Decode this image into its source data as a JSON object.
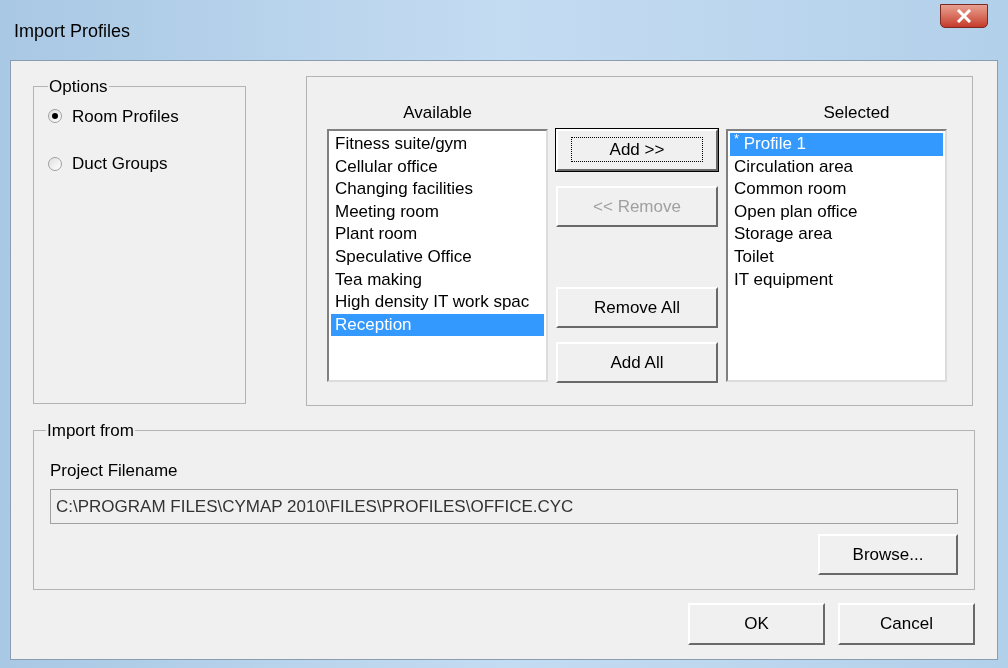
{
  "window": {
    "title": "Import Profiles"
  },
  "options": {
    "legend": "Options",
    "radios": [
      {
        "label": "Room Profiles",
        "selected": true
      },
      {
        "label": "Duct Groups",
        "selected": false
      }
    ]
  },
  "available": {
    "label": "Available",
    "items": [
      {
        "label": "Fitness suite/gym",
        "selected": false
      },
      {
        "label": "Cellular office",
        "selected": false
      },
      {
        "label": "Changing facilities",
        "selected": false
      },
      {
        "label": "Meeting room",
        "selected": false
      },
      {
        "label": "Plant room",
        "selected": false
      },
      {
        "label": "Speculative Office",
        "selected": false
      },
      {
        "label": "Tea making",
        "selected": false
      },
      {
        "label": "High density IT work spac",
        "selected": false
      },
      {
        "label": "Reception",
        "selected": true
      }
    ]
  },
  "transfer_buttons": [
    {
      "label": "Add >>",
      "disabled": false,
      "default": true
    },
    {
      "label": "<< Remove",
      "disabled": true,
      "default": false
    },
    {
      "label": "Remove All",
      "disabled": false,
      "default": false
    },
    {
      "label": "Add All",
      "disabled": false,
      "default": false
    }
  ],
  "selected_list": {
    "label": "Selected",
    "items": [
      {
        "label": "$^{*}$ Profile 1",
        "selected": true
      },
      {
        "label": "Circulation area",
        "selected": false
      },
      {
        "label": "Common room",
        "selected": false
      },
      {
        "label": "Open plan office",
        "selected": false
      },
      {
        "label": "Storage area",
        "selected": false
      },
      {
        "label": "Toilet",
        "selected": false
      },
      {
        "label": "IT equipment",
        "selected": false
      }
    ]
  },
  "import_from": {
    "legend": "Import from",
    "filename_label": "Project Filename",
    "filename": "C:\\PROGRAM FILES\\CYMAP 2010\\FILES\\PROFILES\\OFFICE.CYC",
    "browse": "Browse..."
  },
  "buttons": [
    "OK",
    "Cancel"
  ]
}
